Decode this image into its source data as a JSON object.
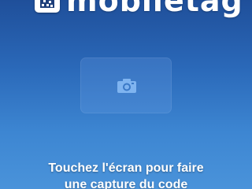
{
  "app": {
    "name": "mobiletag",
    "brand_icon": "qr-code-icon"
  },
  "capture": {
    "icon": "camera-icon"
  },
  "instruction": {
    "line1": "Touchez l'écran pour faire",
    "line2": "une capture du code"
  },
  "colors": {
    "background_top": "#1f4f9a",
    "background_bottom": "#4a93da",
    "text": "#ffffff",
    "capture_button": "#5f97dc",
    "camera_icon": "#7fb4f0"
  }
}
